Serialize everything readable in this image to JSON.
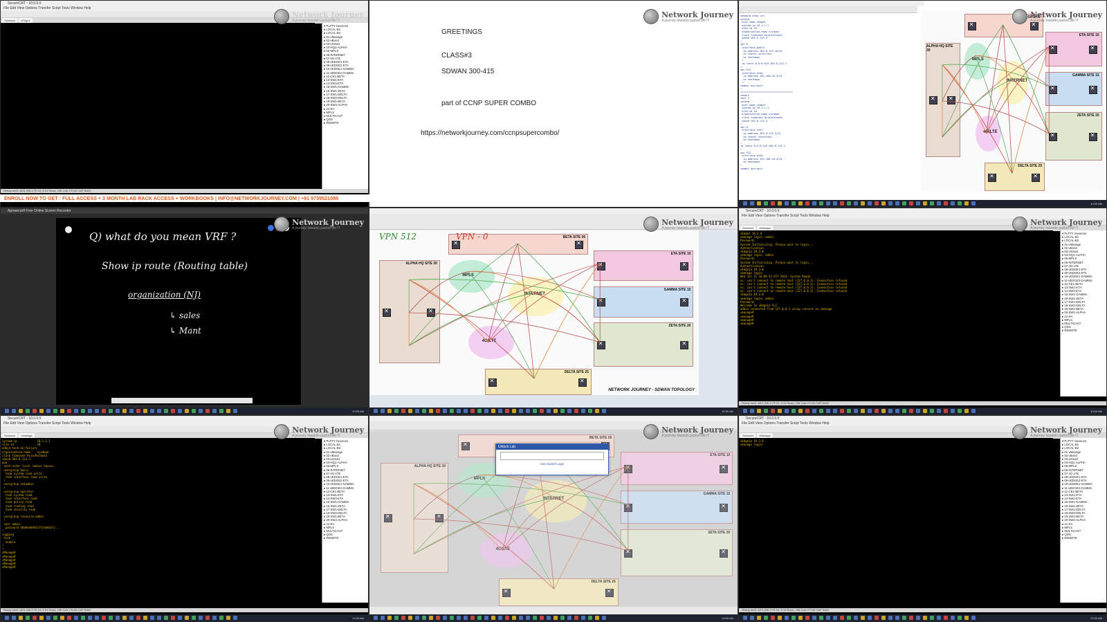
{
  "brand": {
    "name": "Network Journey",
    "tagline": "A journey towards packet life !!!"
  },
  "banner": {
    "text": "ENROLL NOW TO GET : FULL ACCESS + 2 MONTH LAB RACK ACCESS + WORKBOOKS |  INFO@NETWORKJOURNEY.COM | +91 9739521088"
  },
  "slide": {
    "line1": "GREETINGS",
    "line2": "CLASS#3",
    "line3": "SDWAN 300-415",
    "line4": "part of CCNP SUPER COMBO",
    "url": "https://networkjourney.com/ccnpsupercombo/"
  },
  "whiteboard": {
    "app_title": "Apowersoft Free Online Screen Recorder",
    "question": "Q) what do you mean VRF ?",
    "line2": "Show ip route (Routing table)",
    "line3": "organization (NJ)",
    "item1": "sales",
    "item2": "Mant"
  },
  "terminal_app": {
    "title": "SecureCRT - 10.0.0.0",
    "menu": "File  Edit  View  Options  Transfer  Script  Tools  Window  Help",
    "tabs": [
      "Sessions",
      "vEdge1",
      "vBond",
      "vSmart",
      "vManage"
    ],
    "status": "Ready   ssh2: AES-256-CTR   24, 8  24 Rows, 106 Cols  VT100  CAP NUM"
  },
  "session_tree": [
    "PuTTY Sessions",
    "LOCAL-B1",
    "LOCAL-B2",
    "01-vManage",
    "02-vBond",
    "03-vSmart",
    "04-HQ1-ALPHA",
    "05-MPLS",
    "06-INTERNET",
    "07-4G-LTE",
    "08-vEDGE1-ETA",
    "09-vEDGE2-ETA",
    "10-vEDGE1-GAMMA",
    "11-vEDGE2-GAMMA",
    "12-CE1-BETA",
    "13-SW1-ETA",
    "14-SW2-ETA",
    "15-SW1-GAMMA",
    "16-SW1-ZETA",
    "17-SW1-DELTA",
    "18-SW2-DELTA",
    "19-SW1-BETA",
    "20-SW2-ALPHA",
    "21-RA",
    "MPLS",
    "MULTICAST",
    "QOS",
    "REMOTE"
  ],
  "term_tr": [
    "vedge1# show run",
    "system",
    " host-name vEdge1",
    " system-ip 10.1.1.2",
    " site-id 10",
    " organization-name njsdwan",
    " clock timezone Asia/Kolkata",
    " vbond 203.0.113.3",
    "!",
    "vpn 0",
    " interface ge0/0",
    "  ip address 203.0.113.10/24",
    "  no tunnel-interface",
    "  no shutdown",
    " !",
    " ip route 0.0.0.0/0 203.0.113.1",
    "!",
    "vpn 512",
    " interface eth0",
    "  ip address 192.168.10.3/24",
    "  no shutdown",
    " !",
    "commit and-quit",
    "!",
    "===================================",
    "vsmart",
    "conf t",
    "system",
    " host-name vSmart",
    " system-ip 10.1.1.3",
    " site-id 10",
    " organization-name njsdwan",
    " clock timezone Asia/Kolkata",
    " vbond 203.0.113.3",
    "!",
    "vpn 0",
    " interface eth1",
    "  ip address 203.0.113.5/24",
    "  no tunnel-interface",
    "  no shutdown",
    "!",
    "ip route 0.0.0.0/0 203.0.113.1",
    "!",
    "vpn 512",
    " interface eth0",
    "  ip address 192.168.10.4/24",
    "  no shutdown",
    "!",
    "commit and-quit"
  ],
  "term_mr": [
    "vEdge1 19.3.0",
    "",
    "vmanage login: admin",
    "Password:",
    "",
    "System Initializing. Please wait to login...",
    "",
    "",
    "Authentication",
    "vEdge1a 19.3.0",
    "",
    "vmanage login: admin",
    "Password:",
    "",
    "System Initializing. Please wait to login...",
    "",
    "Authentication",
    "vEdge1a 19.3.0",
    "",
    "vmanage login:",
    "",
    "Wed Jul 21 10:09:53 EST 2021: System Ready",
    "",
    "ec: can't connect to remote host (127.0.0.1): Connection refused",
    "ec: can't connect to remote host (127.0.0.1): Connection refused",
    "ec: can't connect to remote host (127.0.0.1): Connection refused",
    "ec: can't connect to remote host (127.0.0.1): Connection refused",
    "",
    "vEdge1a 19.3.0",
    "",
    "vmanage login: admin",
    "Password:",
    "Welcome to vEdge1a CLI",
    "admin connected from 127.0.0.1 using console on vmanage",
    "vmanage#",
    "vmanage#",
    "vmanage#",
    "vmanage#"
  ],
  "term_bl": [
    "system-ip            10.1.1.1",
    "site-id              10",
    "admin-tech-on-failure",
    "organization-name    njsdwan",
    "clock timezone Asia/Kolkata",
    "vbond 203.0.113.3",
    "aaa",
    " auth-order local radius tacacs",
    " usergroup basic",
    "  task system read write",
    "  task interface read write",
    " !",
    " usergroup netadmin",
    " !",
    " usergroup operator",
    "  task system read",
    "  task interface read",
    "  task policy read",
    "  task routing read",
    "  task security read",
    " !",
    " usergroup resource-admin",
    " !",
    " user admin",
    "  password $6$8e4b9d3c7f2a$kQx7j...",
    "!",
    "logging",
    " disk",
    "  enable",
    "!",
    "!",
    "vManage#",
    "vManage#",
    "vManage#",
    "vManage#",
    "vManage#"
  ],
  "term_br": [
    "vEdge1a 19.3.0",
    "",
    "vmanage login: "
  ],
  "topology": {
    "title": "NETWORK JOURNEY - SDWAN TOPOLOGY",
    "sites": [
      "BETA SITE 05",
      "ALPHA HQ SITE 30",
      "ETA SITE 10",
      "GAMMA SITE 15",
      "ZETA SITE 20",
      "DELTA SITE 25"
    ],
    "clouds": [
      "MPLS",
      "INTERNET",
      "4G/LTE"
    ],
    "annotations": [
      "VPN 512",
      "VPN - 0"
    ],
    "dialog_title": "Unlock Lab",
    "dialog_button": "Use Saved Login"
  },
  "taskbar": {
    "clock": "10:09 AM"
  }
}
